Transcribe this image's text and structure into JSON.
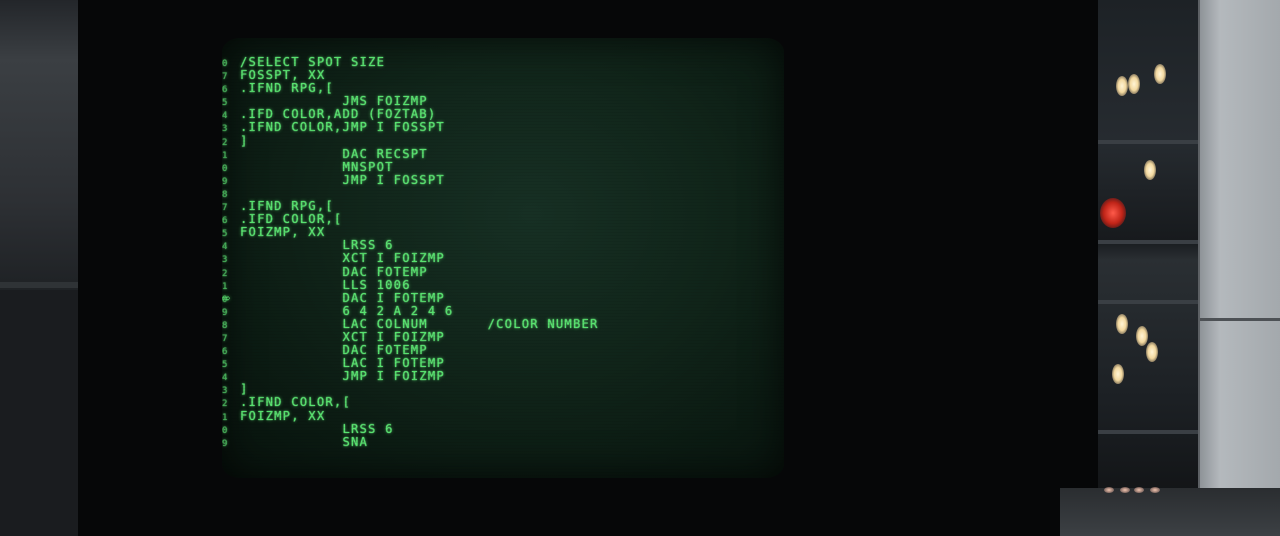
{
  "screen": {
    "phosphor_color": "#58e26f",
    "lines": [
      {
        "num": "0",
        "text": "/SELECT SPOT SIZE"
      },
      {
        "num": "7",
        "text": "FOSSPT, XX"
      },
      {
        "num": "6",
        "text": ".IFND RPG,["
      },
      {
        "num": "5",
        "text": "            JMS FOIZMP"
      },
      {
        "num": "4",
        "text": ".IFD COLOR,ADD (FOZTAB)"
      },
      {
        "num": "3",
        "text": ".IFND COLOR,JMP I FOSSPT"
      },
      {
        "num": "2",
        "text": "]"
      },
      {
        "num": "1",
        "text": "            DAC RECSPT"
      },
      {
        "num": "0",
        "text": "            MNSPOT"
      },
      {
        "num": "9",
        "text": "            JMP I FOSSPT"
      },
      {
        "num": "8",
        "text": ""
      },
      {
        "num": "7",
        "text": ".IFND RPG,["
      },
      {
        "num": "6",
        "text": ".IFD COLOR,["
      },
      {
        "num": "5",
        "text": "FOIZMP, XX"
      },
      {
        "num": "4",
        "text": "            LRSS 6"
      },
      {
        "num": "3",
        "text": "            XCT I FOIZMP"
      },
      {
        "num": "2",
        "text": "            DAC FOTEMP"
      },
      {
        "num": "1",
        "text": "            LLS 1006"
      },
      {
        "num": "0",
        "text": "            DAC I FOTEMP"
      },
      {
        "num": "9",
        "text": "            6 4 2 A 2 4 6"
      },
      {
        "num": "8",
        "text": "            LAC COLNUM       /COLOR NUMBER"
      },
      {
        "num": "7",
        "text": "            XCT I FOIZMP"
      },
      {
        "num": "6",
        "text": "            DAC FOTEMP"
      },
      {
        "num": "5",
        "text": "            LAC I FOTEMP"
      },
      {
        "num": "4",
        "text": "            JMP I FOIZMP"
      },
      {
        "num": "3",
        "text": "]"
      },
      {
        "num": "2",
        "text": ".IFND COLOR,["
      },
      {
        "num": "1",
        "text": "FOIZMP, XX"
      },
      {
        "num": "0",
        "text": "            LRSS 6"
      },
      {
        "num": "9",
        "text": "            SNA"
      }
    ],
    "cursor_glyph": "⇨"
  }
}
